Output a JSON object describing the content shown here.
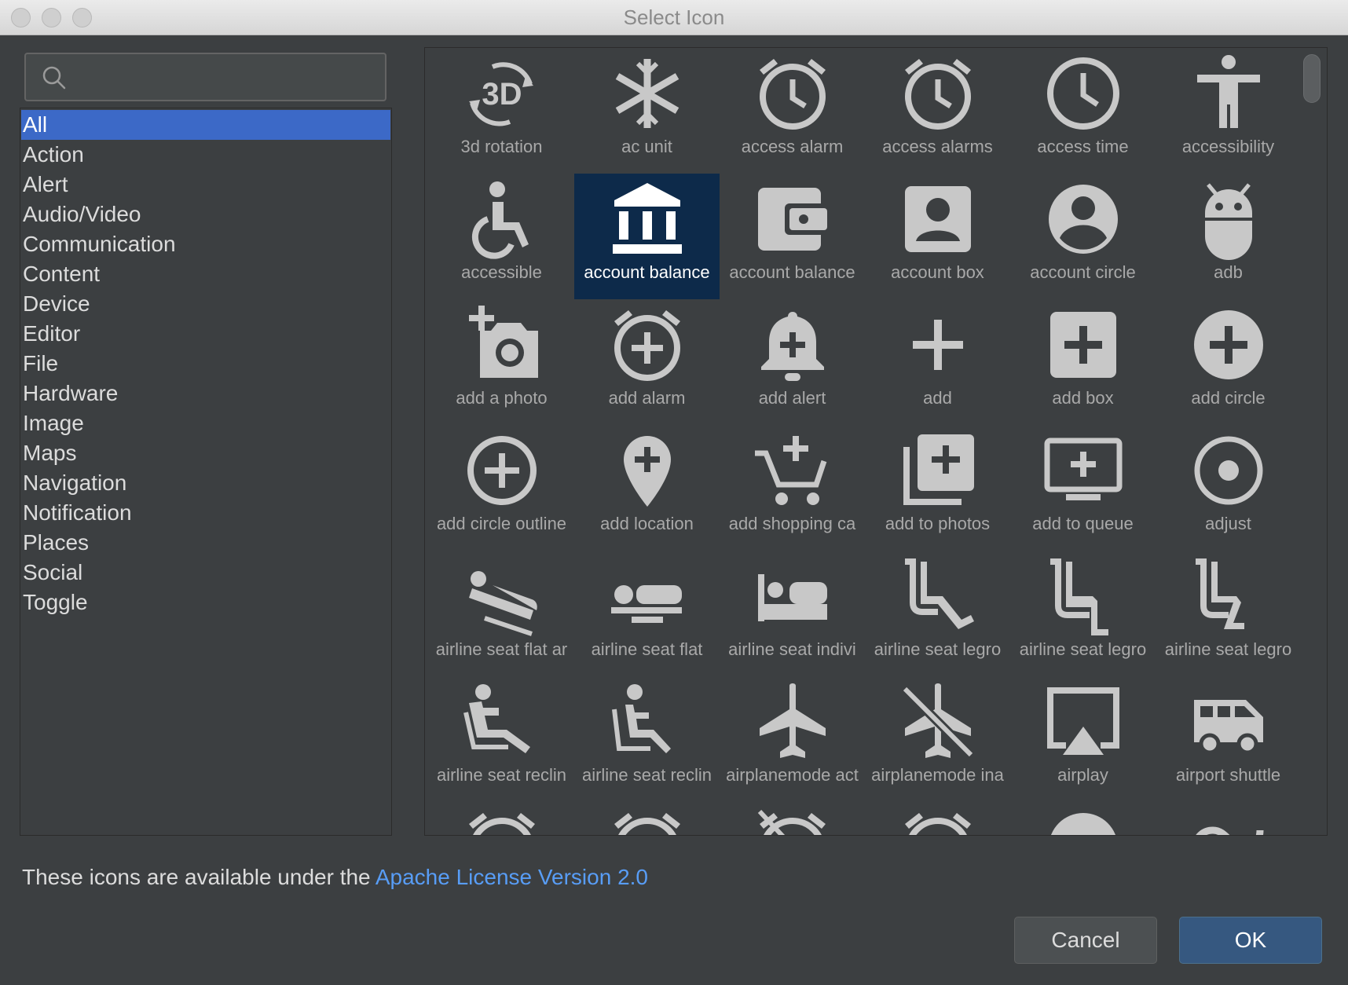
{
  "window": {
    "title": "Select Icon"
  },
  "search": {
    "value": "",
    "placeholder": ""
  },
  "categories": [
    {
      "label": "All",
      "selected": true
    },
    {
      "label": "Action"
    },
    {
      "label": "Alert"
    },
    {
      "label": "Audio/Video"
    },
    {
      "label": "Communication"
    },
    {
      "label": "Content"
    },
    {
      "label": "Device"
    },
    {
      "label": "Editor"
    },
    {
      "label": "File"
    },
    {
      "label": "Hardware"
    },
    {
      "label": "Image"
    },
    {
      "label": "Maps"
    },
    {
      "label": "Navigation"
    },
    {
      "label": "Notification"
    },
    {
      "label": "Places"
    },
    {
      "label": "Social"
    },
    {
      "label": "Toggle"
    }
  ],
  "icons": [
    {
      "label": "3d rotation",
      "icon": "3d-rotation-icon"
    },
    {
      "label": "ac unit",
      "icon": "ac-unit-icon"
    },
    {
      "label": "access alarm",
      "icon": "access-alarm-icon"
    },
    {
      "label": "access alarms",
      "icon": "access-alarms-icon"
    },
    {
      "label": "access time",
      "icon": "access-time-icon"
    },
    {
      "label": "accessibility",
      "icon": "accessibility-icon"
    },
    {
      "label": "accessible",
      "icon": "accessible-icon"
    },
    {
      "label": "account balance",
      "icon": "account-balance-icon",
      "selected": true
    },
    {
      "label": "account balance",
      "icon": "account-balance-wallet-icon"
    },
    {
      "label": "account box",
      "icon": "account-box-icon"
    },
    {
      "label": "account circle",
      "icon": "account-circle-icon"
    },
    {
      "label": "adb",
      "icon": "adb-icon"
    },
    {
      "label": "add a photo",
      "icon": "add-a-photo-icon"
    },
    {
      "label": "add alarm",
      "icon": "add-alarm-icon"
    },
    {
      "label": "add alert",
      "icon": "add-alert-icon"
    },
    {
      "label": "add",
      "icon": "add-icon"
    },
    {
      "label": "add box",
      "icon": "add-box-icon"
    },
    {
      "label": "add circle",
      "icon": "add-circle-icon"
    },
    {
      "label": "add circle outline",
      "icon": "add-circle-outline-icon"
    },
    {
      "label": "add location",
      "icon": "add-location-icon"
    },
    {
      "label": "add shopping ca",
      "icon": "add-shopping-cart-icon"
    },
    {
      "label": "add to photos",
      "icon": "add-to-photos-icon"
    },
    {
      "label": "add to queue",
      "icon": "add-to-queue-icon"
    },
    {
      "label": "adjust",
      "icon": "adjust-icon"
    },
    {
      "label": "airline seat flat ar",
      "icon": "airline-seat-flat-angled-icon"
    },
    {
      "label": "airline seat flat",
      "icon": "airline-seat-flat-icon"
    },
    {
      "label": "airline seat indivi",
      "icon": "airline-seat-individual-suite-icon"
    },
    {
      "label": "airline seat legro",
      "icon": "airline-seat-legroom-extra-icon"
    },
    {
      "label": "airline seat legro",
      "icon": "airline-seat-legroom-normal-icon"
    },
    {
      "label": "airline seat legro",
      "icon": "airline-seat-legroom-reduced-icon"
    },
    {
      "label": "airline seat reclin",
      "icon": "airline-seat-recline-extra-icon"
    },
    {
      "label": "airline seat reclin",
      "icon": "airline-seat-recline-normal-icon"
    },
    {
      "label": "airplanemode act",
      "icon": "airplanemode-active-icon"
    },
    {
      "label": "airplanemode ina",
      "icon": "airplanemode-inactive-icon"
    },
    {
      "label": "airplay",
      "icon": "airplay-icon"
    },
    {
      "label": "airport shuttle",
      "icon": "airport-shuttle-icon"
    },
    {
      "label": "",
      "icon": "alarm-icon"
    },
    {
      "label": "",
      "icon": "alarm-add-icon"
    },
    {
      "label": "",
      "icon": "alarm-off-icon"
    },
    {
      "label": "",
      "icon": "alarm-on-icon"
    },
    {
      "label": "",
      "icon": "album-icon"
    },
    {
      "label": "",
      "icon": "all-inclusive-icon"
    }
  ],
  "footer": {
    "license_text": "These icons are available under the ",
    "license_link": "Apache License Version 2.0",
    "cancel_label": "Cancel",
    "ok_label": "OK"
  },
  "colors": {
    "accent": "#3c69c7",
    "link": "#589df6",
    "icon": "#c8c8c8",
    "selected_cell": "#0d2a4a"
  }
}
